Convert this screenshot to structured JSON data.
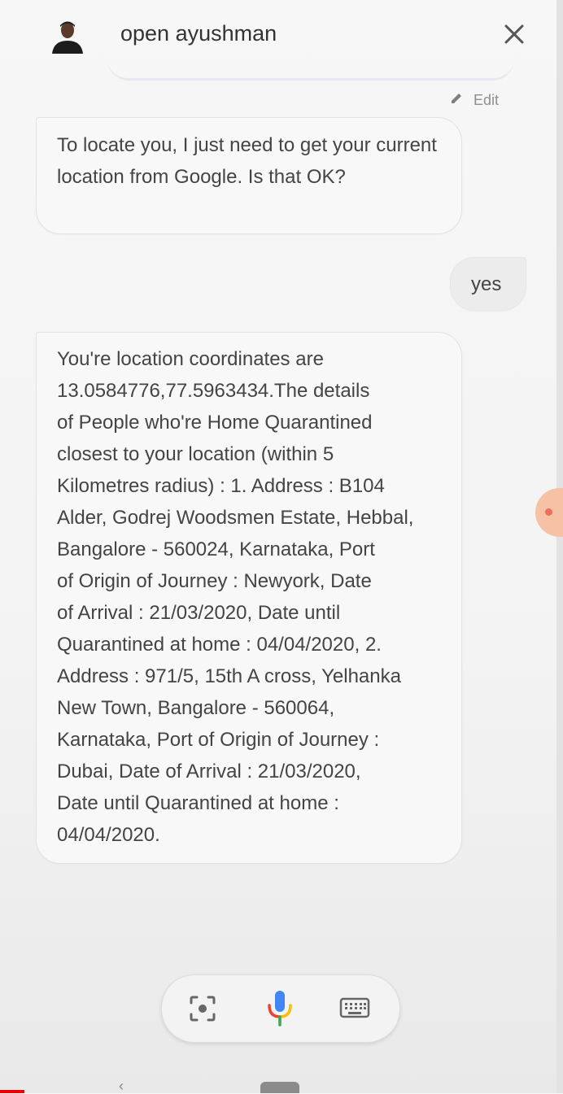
{
  "header": {
    "title": "open ayushman",
    "avatar_icon": "person-avatar",
    "close_icon": "close-icon"
  },
  "edit": {
    "label": "Edit",
    "icon": "pencil-icon"
  },
  "messages": [
    {
      "role": "assistant",
      "text": "To locate you, I just need to get your current location from Google. Is that OK?"
    },
    {
      "role": "user",
      "text": "yes"
    },
    {
      "role": "assistant",
      "text": "You're location coordinates are\n13.0584776,77.5963434.The details\nof People who're Home Quarantined\nclosest to your location (within 5\nKilometres radius) : 1. Address : B104\nAlder, Godrej Woodsmen Estate, Hebbal,\nBangalore - 560024, Karnataka, Port\nof Origin of Journey : Newyork, Date\nof Arrival : 21/03/2020, Date until\nQuarantined at home : 04/04/2020, 2.\nAddress : 971/5, 15th A cross, Yelhanka\nNew Town, Bangalore - 560064,\nKarnataka, Port of Origin of Journey :\nDubai, Date of Arrival : 21/03/2020,\nDate until Quarantined at home :\n04/04/2020."
    }
  ],
  "bottom_bar": {
    "lens_icon": "lens-icon",
    "mic_icon": "mic-icon",
    "keyboard_icon": "keyboard-icon"
  },
  "colors": {
    "bubble_bg": "#f8f8f8",
    "user_bubble_bg": "#ececec",
    "mic_blue": "#4285f4",
    "mic_red": "#ea4335",
    "mic_yellow": "#fbbc05",
    "mic_green": "#34a853"
  }
}
